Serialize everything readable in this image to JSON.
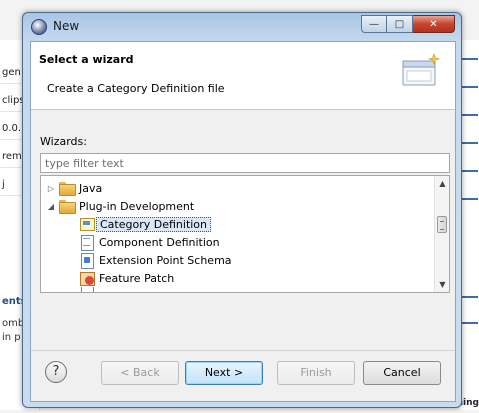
{
  "window": {
    "title": "New",
    "controls": {
      "minimize": "—",
      "maximize": "□",
      "close": "✕"
    }
  },
  "header": {
    "title": "Select a wizard",
    "description": "Create a Category Definition file"
  },
  "wizards_label": "Wizards:",
  "filter": {
    "placeholder": "type filter text",
    "value": ""
  },
  "tree": {
    "items": [
      {
        "label": "Java",
        "level": 0,
        "expanded": false,
        "icon": "folder-icon"
      },
      {
        "label": "Plug-in Development",
        "level": 0,
        "expanded": true,
        "icon": "folder-icon"
      },
      {
        "label": "Category Definition",
        "level": 1,
        "selected": true,
        "icon": "category-definition-icon"
      },
      {
        "label": "Component Definition",
        "level": 1,
        "icon": "component-definition-icon"
      },
      {
        "label": "Extension Point Schema",
        "level": 1,
        "icon": "extension-point-schema-icon"
      },
      {
        "label": "Feature Patch",
        "level": 1,
        "icon": "feature-patch-icon"
      }
    ]
  },
  "buttons": {
    "help": "?",
    "back": "< Back",
    "next": "Next >",
    "finish": "Finish",
    "cancel": "Cancel",
    "back_enabled": false,
    "finish_enabled": false,
    "default": "next"
  },
  "background": {
    "left_rows": [
      "gen",
      "clips",
      "0.0.",
      "rem",
      "j"
    ],
    "left_heading": "ents",
    "left_text": [
      "omb",
      "in p"
    ],
    "right_text": "Publishing"
  }
}
